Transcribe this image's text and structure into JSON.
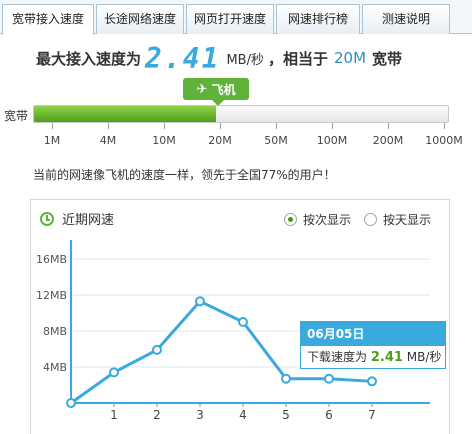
{
  "tabs": [
    {
      "label": "宽带接入速度",
      "active": true
    },
    {
      "label": "长途网络速度",
      "active": false
    },
    {
      "label": "网页打开速度",
      "active": false
    },
    {
      "label": "网速排行榜",
      "active": false
    },
    {
      "label": "测速说明",
      "active": false
    }
  ],
  "headline": {
    "prefix": "最大接入速度为",
    "speed": "2.41",
    "unit": "MB/秒",
    "middle": "，相当于",
    "bandwidth": "20M",
    "suffix": "宽带"
  },
  "badge": {
    "icon": "airplane-icon",
    "label": "飞机"
  },
  "bar": {
    "label": "宽带",
    "fill_fraction": 0.44,
    "scale": [
      "1M",
      "4M",
      "10M",
      "20M",
      "50M",
      "100M",
      "200M",
      "1000M"
    ]
  },
  "compare_text": "当前的网速像飞机的速度一样，领先于全国77%的用户！",
  "panel": {
    "title": "近期网速",
    "title_icon": "clock-icon",
    "radio_options": [
      {
        "label": "按次显示",
        "selected": true
      },
      {
        "label": "按天显示",
        "selected": false
      }
    ]
  },
  "tooltip": {
    "date": "06月05日",
    "prefix": "下载速度为",
    "value": "2.41",
    "unit": "MB/秒"
  },
  "colors": {
    "accent_blue": "#3aa9dd",
    "accent_green": "#5fb23a"
  },
  "chart_data": {
    "type": "line",
    "x": [
      0,
      1,
      2,
      3,
      4,
      5,
      6,
      7
    ],
    "x_tick_labels": [
      "1",
      "2",
      "3",
      "4",
      "5",
      "6",
      "7"
    ],
    "y_tick_labels": [
      "4MB",
      "8MB",
      "12MB",
      "16MB"
    ],
    "ylim": [
      0,
      18
    ],
    "series": [
      {
        "values": [
          0,
          3.4,
          5.9,
          11.3,
          9.0,
          2.7,
          2.7,
          2.41
        ]
      }
    ],
    "grid": true
  }
}
